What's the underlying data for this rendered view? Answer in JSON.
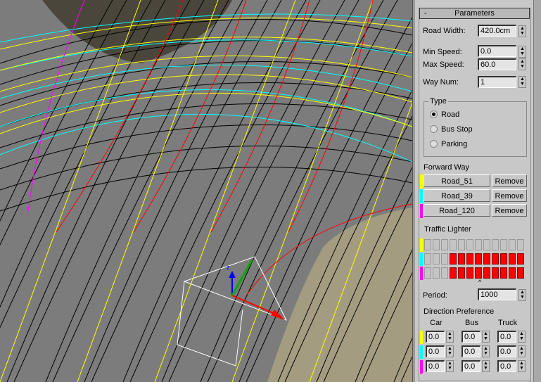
{
  "viewport": {
    "colors": {
      "background": "#7c7c7c",
      "ground": "#a39c80",
      "dark_area": "#4a463c",
      "lines": "#000000",
      "yellow": "#ffff00",
      "cyan": "#00ffff",
      "magenta": "#ff00ff",
      "red": "#ff0000"
    },
    "gizmo_axis_label": "z"
  },
  "panel": {
    "title": "Parameters",
    "collapse_symbol": "-",
    "road_width": {
      "label": "Road Width:",
      "value": "420.0cm"
    },
    "min_speed": {
      "label": "Min Speed:",
      "value": "0.0"
    },
    "max_speed": {
      "label": "Max Speed:",
      "value": "60.0"
    },
    "way_num": {
      "label": "Way Num:",
      "value": "1"
    },
    "type": {
      "label": "Type",
      "options": [
        "Road",
        "Bus Stop",
        "Parking"
      ],
      "selected": "Road"
    },
    "forward_way": {
      "label": "Forward Way",
      "items": [
        {
          "name": "Road_51",
          "remove": "Remove",
          "color": "#ffff00"
        },
        {
          "name": "Road_39",
          "remove": "Remove",
          "color": "#00ffff"
        },
        {
          "name": "Road_120",
          "remove": "Remove",
          "color": "#ff00ff"
        }
      ]
    },
    "traffic_lighter": {
      "label": "Traffic Lighter",
      "rows": [
        {
          "color": "#ffff00",
          "cells": [
            0,
            0,
            0,
            0,
            0,
            0,
            0,
            0,
            0,
            0,
            0,
            0
          ]
        },
        {
          "color": "#00ffff",
          "cells": [
            0,
            0,
            0,
            1,
            1,
            1,
            1,
            1,
            1,
            1,
            1,
            1
          ]
        },
        {
          "color": "#ff00ff",
          "cells": [
            0,
            0,
            0,
            1,
            1,
            1,
            1,
            1,
            1,
            1,
            1,
            1
          ]
        }
      ],
      "cursor_symbol": "^"
    },
    "period": {
      "label": "Period:",
      "value": "1000"
    },
    "direction_preference": {
      "label": "Direction Preference",
      "columns": [
        "Car",
        "Bus",
        "Truck"
      ],
      "rows": [
        {
          "color": "#ffff00",
          "values": [
            "0.0",
            "0.0",
            "0.0"
          ]
        },
        {
          "color": "#00ffff",
          "values": [
            "0.0",
            "0.0",
            "0.0"
          ]
        },
        {
          "color": "#ff00ff",
          "values": [
            "0.0",
            "0.0",
            "0.0"
          ]
        }
      ]
    }
  }
}
